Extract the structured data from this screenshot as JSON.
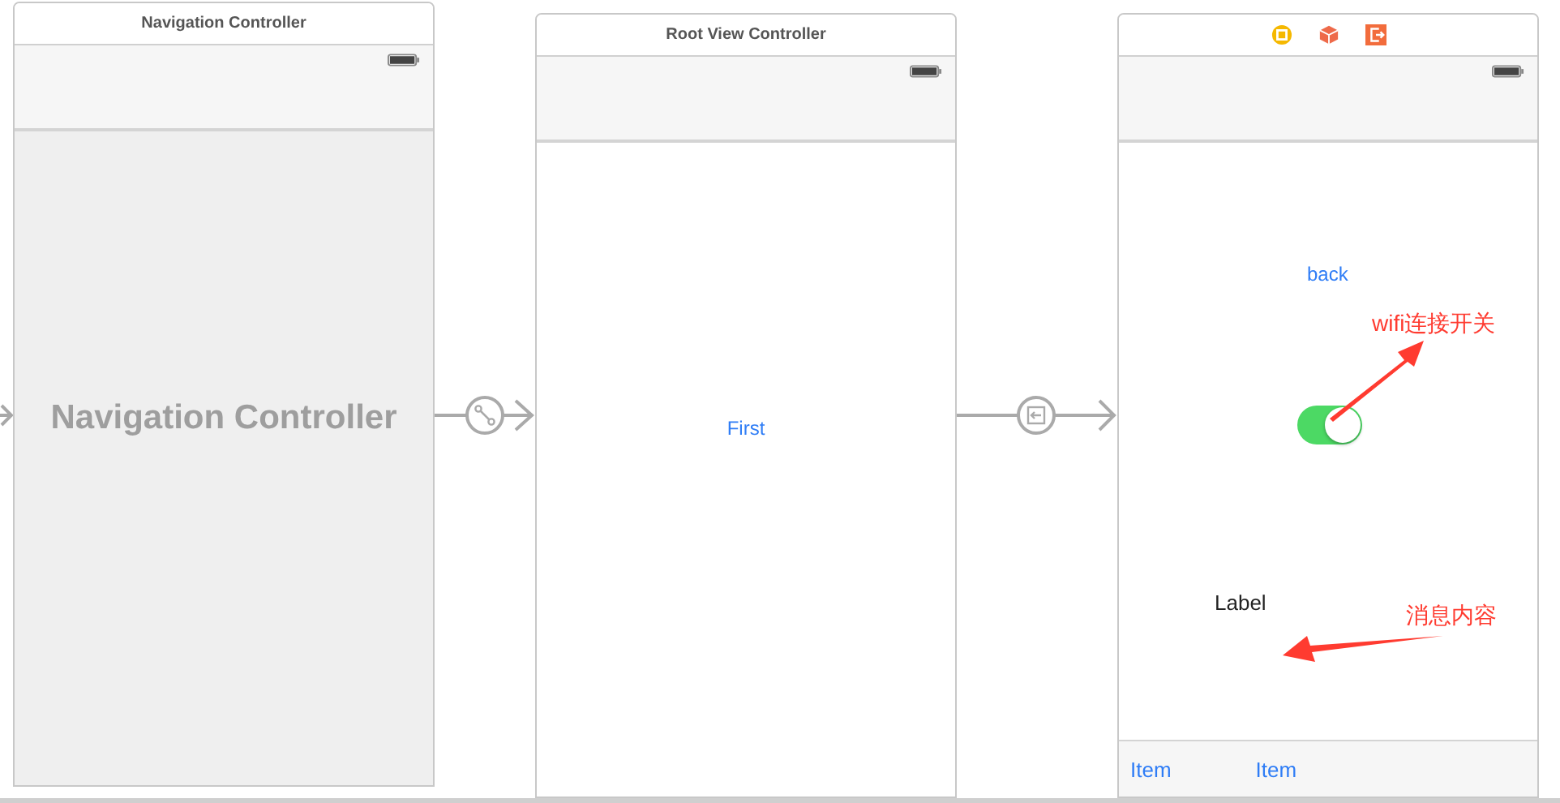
{
  "scenes": [
    {
      "kind": "navigation",
      "title": "Navigation Controller",
      "placeholder_title": "Navigation Controller"
    },
    {
      "kind": "root",
      "title": "Root View Controller",
      "button": "First"
    },
    {
      "kind": "detail",
      "back": "back",
      "switch": {
        "on": true
      },
      "label": "Label",
      "tab_items": [
        "Item",
        "Item"
      ]
    }
  ],
  "annotations": [
    {
      "text": "wifi连接开关",
      "color": "#ff3b30"
    },
    {
      "text": "消息内容",
      "color": "#ff3b30"
    }
  ]
}
